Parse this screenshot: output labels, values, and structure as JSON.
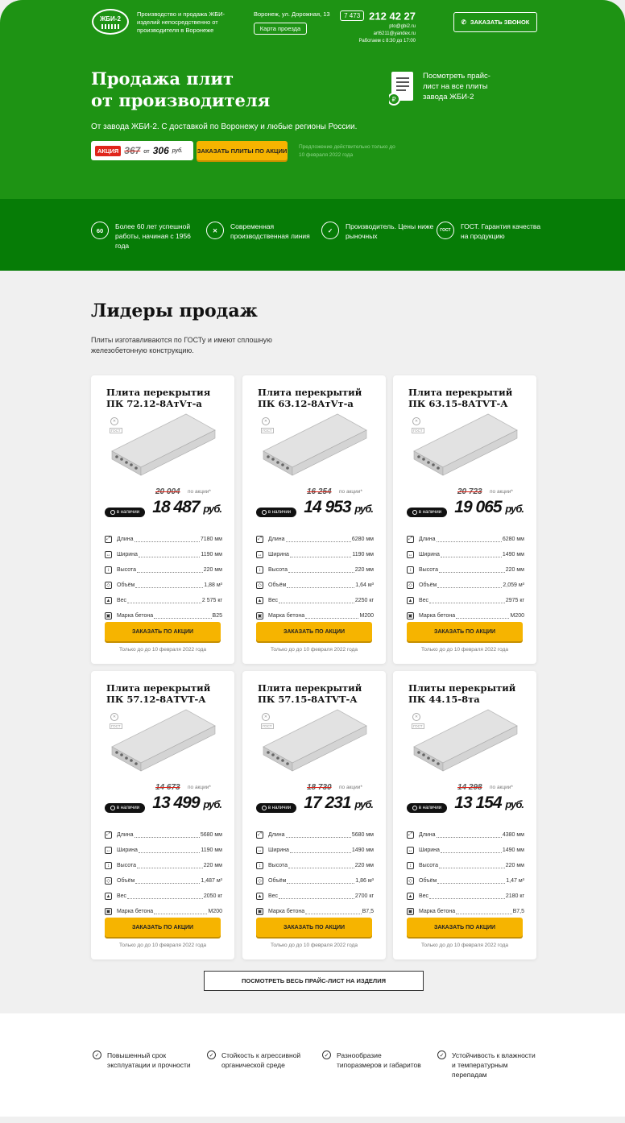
{
  "header": {
    "logo_text": "ЖБИ-2",
    "tagline": "Производство и продажа ЖБИ-изделий непосредственно от производителя в Воронеже",
    "address": "Воронеж, ул. Дорожная, 13",
    "map_button": "Карта проезда",
    "phone_code": "7 473",
    "phone_number": "212 42 27",
    "email1": "pto@gbi2.ru",
    "email2": "art6211@yandex.ru",
    "hours": "Работаем с 8:30 до 17:00",
    "call_button": "ЗАКАЗАТЬ ЗВОНОК"
  },
  "hero": {
    "title_line1": "Продажа плит",
    "title_line2": "от производителя",
    "subtitle": "От завода ЖБИ-2. С доставкой по Воронежу и любые регионы России.",
    "promo_badge": "АКЦИЯ",
    "promo_old": "367",
    "promo_ot": "от",
    "promo_new": "306",
    "promo_currency": "руб.",
    "order_button": "ЗАКАЗАТЬ ПЛИТЫ ПО АКЦИИ",
    "offer_note": "Предложение действительно только до 10 февраля 2022 года",
    "price_list_link": "Посмотреть прайс-лист на все плиты завода ЖБИ-2"
  },
  "features": [
    {
      "icon_text": "60",
      "text": "Более 60 лет успешной работы, начиная с 1956 года"
    },
    {
      "icon_text": "✕",
      "text": "Современная производственная линия"
    },
    {
      "icon_text": "✓",
      "text": "Производитель. Цены ниже рыночных"
    },
    {
      "icon_text": "ГОСТ",
      "text": "ГОСТ. Гарантия качества на продукцию"
    }
  ],
  "section": {
    "title": "Лидеры продаж",
    "subtitle": "Плиты изготавливаются по ГОСТу и имеют сплошную железобетонную конструкцию."
  },
  "spec_labels": {
    "length": "Длина",
    "width": "Ширина",
    "height": "Высота",
    "volume": "Объём",
    "weight": "Вес",
    "concrete": "Марка бетона"
  },
  "common": {
    "in_stock": "в наличии",
    "promo_label": "по акции*",
    "currency": "руб.",
    "order_button": "ЗАКАЗАТЬ ПО АКЦИИ",
    "note": "Только до до 10 февраля 2022 года",
    "gost": "ГОСТ"
  },
  "products": [
    {
      "name": "Плита перекрытия ПК 72.12-8АтVт-а",
      "old_price": "20 004",
      "price": "18 487",
      "length": "7180 мм",
      "width": "1190 мм",
      "height": "220 мм",
      "volume": "1,88 м³",
      "weight": "2 575 кг",
      "concrete": "В25"
    },
    {
      "name": "Плита перекрытий ПК 63.12-8АтVт-а",
      "old_price": "16 254",
      "price": "14 953",
      "length": "6280 мм",
      "width": "1190 мм",
      "height": "220 мм",
      "volume": "1,64 м³",
      "weight": "2250 кг",
      "concrete": "М200"
    },
    {
      "name": "Плита перекрытий ПК 63.15-8АТVТ-А",
      "old_price": "20 723",
      "price": "19 065",
      "length": "6280 мм",
      "width": "1490 мм",
      "height": "220 мм",
      "volume": "2,059 м³",
      "weight": "2975 кг",
      "concrete": "М200"
    },
    {
      "name": "Плита перекрытий ПК 57.12-8АТVТ-А",
      "old_price": "14 673",
      "price": "13 499",
      "length": "5680 мм",
      "width": "1190 мм",
      "height": "220 мм",
      "volume": "1,487 м³",
      "weight": "2050 кг",
      "concrete": "М200"
    },
    {
      "name": "Плита перекрытий ПК 57.15-8АТVТ-А",
      "old_price": "18 730",
      "price": "17 231",
      "length": "5680 мм",
      "width": "1490 мм",
      "height": "220 мм",
      "volume": "1,86 м³",
      "weight": "2700 кг",
      "concrete": "В7,5"
    },
    {
      "name": "Плиты перекрытий ПК 44.15-8та",
      "old_price": "14 298",
      "price": "13 154",
      "length": "4380 мм",
      "width": "1490 мм",
      "height": "220 мм",
      "volume": "1,47 м³",
      "weight": "2180 кг",
      "concrete": "В7,5"
    }
  ],
  "all_prices_button": "ПОСМОТРЕТЬ ВЕСЬ ПРАЙС-ЛИСТ НА ИЗДЕЛИЯ",
  "bottom_features": [
    "Повышенный срок эксплуатации и прочности",
    "Стойкость к агрессивной органической среде",
    "Разнообразие типоразмеров и габаритов",
    "Устойчивость к влажности и температурным перепадам"
  ],
  "colors": {
    "primary_green": "#1e9314",
    "dark_green": "#067c06",
    "accent_yellow": "#f6b400",
    "sale_red": "#e0251b"
  }
}
